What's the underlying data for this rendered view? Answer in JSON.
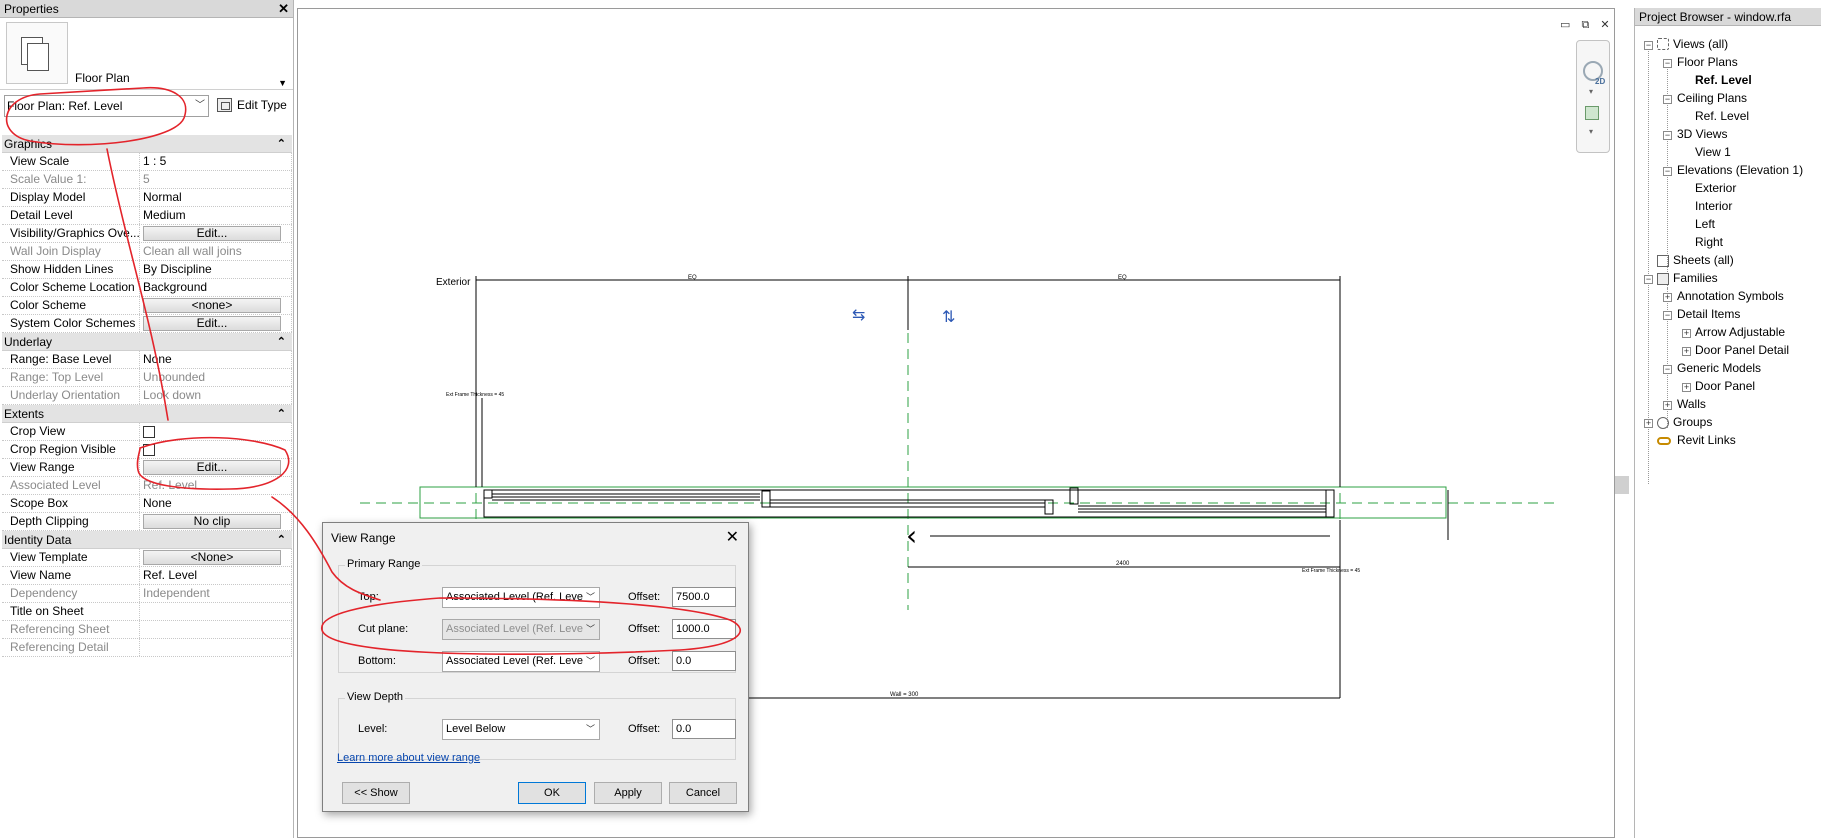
{
  "properties": {
    "title": "Properties",
    "close": "✕",
    "type_name": "Floor Plan",
    "view_selector": "Floor Plan: Ref. Level",
    "edit_type": "Edit Type",
    "groups": {
      "graphics": "Graphics",
      "underlay": "Underlay",
      "extents": "Extents",
      "identity": "Identity Data"
    },
    "collapse": "⌃",
    "graphics_rows": [
      {
        "label": "View Scale",
        "value": "1 : 5"
      },
      {
        "label": "Scale Value    1:",
        "value": "5"
      },
      {
        "label": "Display Model",
        "value": "Normal"
      },
      {
        "label": "Detail Level",
        "value": "Medium"
      },
      {
        "label": "Visibility/Graphics Ove...",
        "value": "Edit..."
      },
      {
        "label": "Wall Join Display",
        "value": "Clean all wall joins"
      },
      {
        "label": "Show Hidden Lines",
        "value": "By Discipline"
      },
      {
        "label": "Color Scheme Location",
        "value": "Background"
      },
      {
        "label": "Color Scheme",
        "value": "<none>"
      },
      {
        "label": "System Color Schemes",
        "value": "Edit..."
      }
    ],
    "underlay_rows": [
      {
        "label": "Range: Base Level",
        "value": "None"
      },
      {
        "label": "Range: Top Level",
        "value": "Unbounded"
      },
      {
        "label": "Underlay Orientation",
        "value": "Look down"
      }
    ],
    "extents_rows": [
      {
        "label": "Crop View",
        "value": ""
      },
      {
        "label": "Crop Region Visible",
        "value": ""
      },
      {
        "label": "View Range",
        "value": "Edit..."
      },
      {
        "label": "Associated Level",
        "value": "Ref. Level"
      },
      {
        "label": "Scope Box",
        "value": "None"
      },
      {
        "label": "Depth Clipping",
        "value": "No clip"
      }
    ],
    "identity_rows": [
      {
        "label": "View Template",
        "value": "<None>"
      },
      {
        "label": "View Name",
        "value": "Ref. Level"
      },
      {
        "label": "Dependency",
        "value": "Independent"
      },
      {
        "label": "Title on Sheet",
        "value": ""
      },
      {
        "label": "Referencing Sheet",
        "value": ""
      },
      {
        "label": "Referencing Detail",
        "value": ""
      }
    ]
  },
  "drawing": {
    "exterior_label": "Exterior",
    "dim_left": "EQ",
    "dim_right": "EQ",
    "dim_bottom": "2400",
    "label_wall": "Wall = 300",
    "label_frame_left": "Ext Frame Thickness = 45",
    "label_frame_right": "Ext Frame Thickness = 45"
  },
  "browser": {
    "title": "Project Browser - window.rfa",
    "items": {
      "views_all": "Views (all)",
      "floor_plans": "Floor Plans",
      "ref_level_fp": "Ref. Level",
      "ceiling_plans": "Ceiling Plans",
      "ref_level_cp": "Ref. Level",
      "views_3d": "3D Views",
      "view1": "View 1",
      "elevations": "Elevations (Elevation 1)",
      "exterior": "Exterior",
      "interior": "Interior",
      "left": "Left",
      "right": "Right",
      "sheets": "Sheets (all)",
      "families": "Families",
      "annotation_symbols": "Annotation Symbols",
      "detail_items": "Detail Items",
      "arrow_adjustable": "Arrow Adjustable",
      "door_panel_detail": "Door Panel Detail",
      "generic_models": "Generic Models",
      "door_panel": "Door Panel",
      "walls": "Walls",
      "groups": "Groups",
      "revit_links": "Revit Links"
    }
  },
  "dialog": {
    "title": "View Range",
    "close": "✕",
    "primary_range": "Primary Range",
    "top_label": "Top:",
    "top_level": "Associated Level (Ref. Leve",
    "top_offset": "7500.0",
    "cut_label": "Cut plane:",
    "cut_level": "Associated Level (Ref. Leve",
    "cut_offset": "1000.0",
    "bottom_label": "Bottom:",
    "bottom_level": "Associated Level (Ref. Leve",
    "bottom_offset": "0.0",
    "offset_label": "Offset:",
    "view_depth": "View Depth",
    "level_label": "Level:",
    "depth_level": "Level Below",
    "depth_offset": "0.0",
    "learn_more": "Learn more about view range",
    "show_btn": "<< Show",
    "ok_btn": "OK",
    "apply_btn": "Apply",
    "cancel_btn": "Cancel"
  },
  "window_controls": "▭ ⧉ ✕",
  "nav_2d": "2D",
  "colors": {
    "annotation_red": "#e3242b",
    "ref_plane_green": "#2ea043",
    "link_blue": "#0645ad",
    "focus_blue": "#0078d7"
  }
}
